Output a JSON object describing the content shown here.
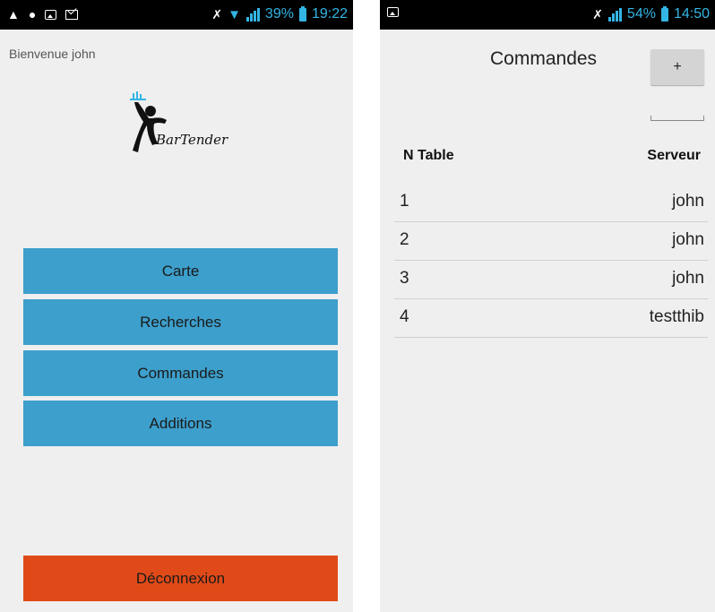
{
  "left_screen": {
    "status": {
      "battery": "39%",
      "time": "19:22"
    },
    "welcome": "Bienvenue john",
    "logo_text": "BarTender",
    "menu": [
      {
        "label": "Carte"
      },
      {
        "label": "Recherches"
      },
      {
        "label": "Commandes"
      },
      {
        "label": "Additions"
      }
    ],
    "logout_label": "Déconnexion",
    "colors": {
      "menu": "#3d9fcc",
      "logout": "#e04a18"
    }
  },
  "right_screen": {
    "status": {
      "battery": "54%",
      "time": "14:50"
    },
    "title": "Commandes",
    "add_label": "+",
    "columns": [
      "N Table",
      "Serveur"
    ],
    "rows": [
      {
        "table": "1",
        "server": "john"
      },
      {
        "table": "2",
        "server": "john"
      },
      {
        "table": "3",
        "server": "john"
      },
      {
        "table": "4",
        "server": "testthib"
      }
    ]
  }
}
